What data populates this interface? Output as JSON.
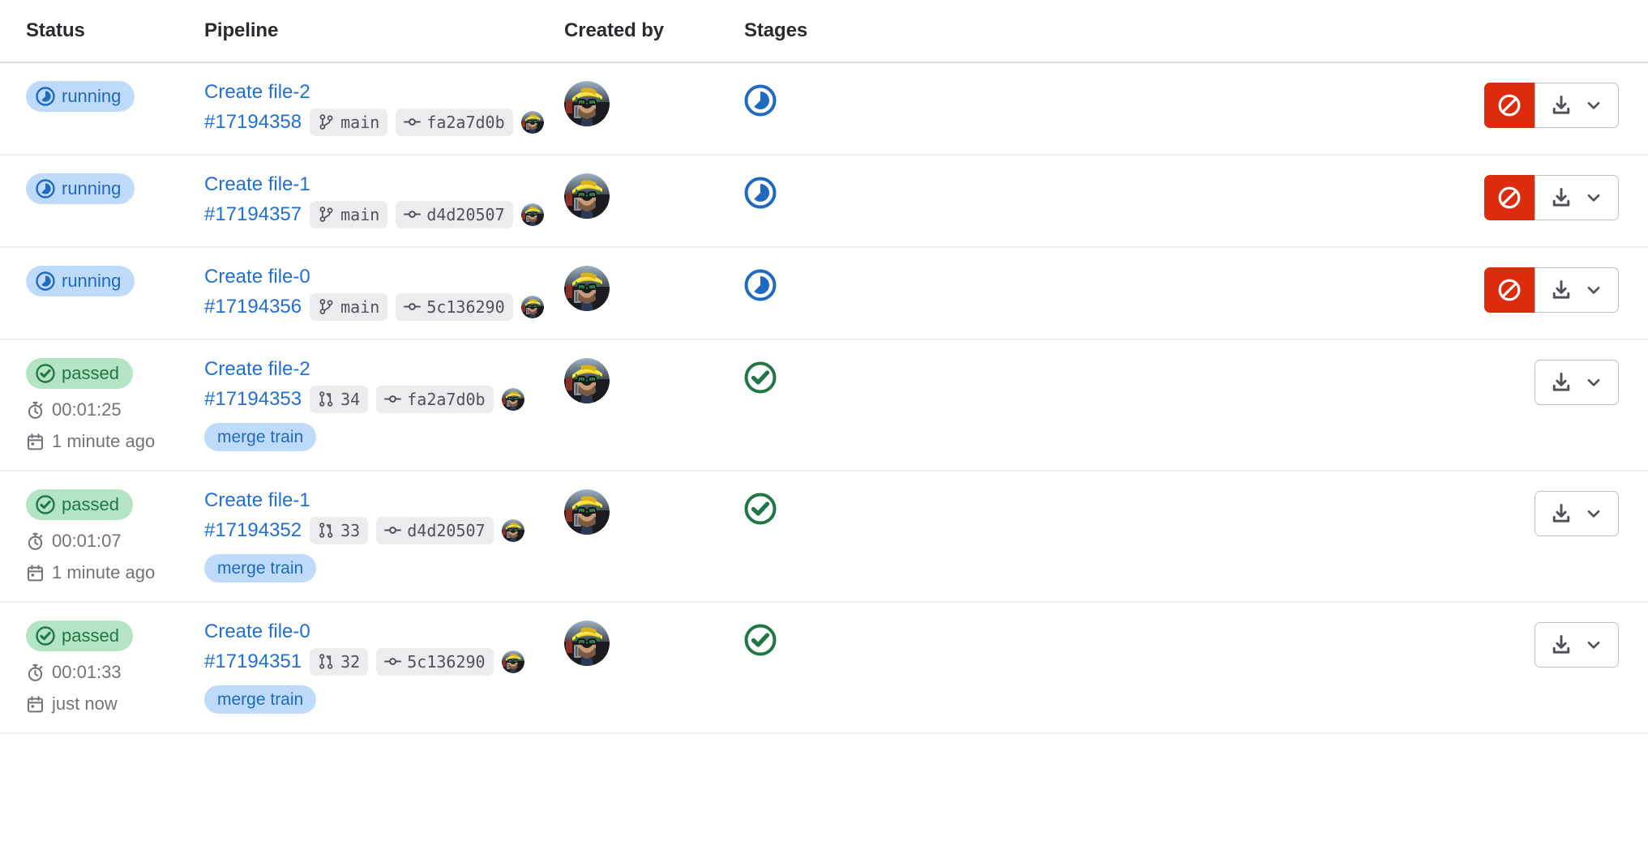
{
  "table": {
    "columns": [
      {
        "key": "status",
        "label": "Status"
      },
      {
        "key": "pipeline",
        "label": "Pipeline"
      },
      {
        "key": "created",
        "label": "Created by"
      },
      {
        "key": "stages",
        "label": "Stages"
      }
    ],
    "rows": [
      {
        "status": {
          "label": "running",
          "type": "running"
        },
        "duration": null,
        "time_ago": null,
        "pipeline": {
          "name": "Create file-2",
          "id": "#17194358",
          "ref_type": "branch",
          "ref": "main",
          "commit": "fa2a7d0b",
          "merge_train": null
        },
        "stage": {
          "type": "running"
        },
        "actions": {
          "cancel": true,
          "download": true,
          "cancel_label": "Cancel pipeline",
          "download_label": "Download artifacts"
        }
      },
      {
        "status": {
          "label": "running",
          "type": "running"
        },
        "duration": null,
        "time_ago": null,
        "pipeline": {
          "name": "Create file-1",
          "id": "#17194357",
          "ref_type": "branch",
          "ref": "main",
          "commit": "d4d20507",
          "merge_train": null
        },
        "stage": {
          "type": "running"
        },
        "actions": {
          "cancel": true,
          "download": true,
          "cancel_label": "Cancel pipeline",
          "download_label": "Download artifacts"
        }
      },
      {
        "status": {
          "label": "running",
          "type": "running"
        },
        "duration": null,
        "time_ago": null,
        "pipeline": {
          "name": "Create file-0",
          "id": "#17194356",
          "ref_type": "branch",
          "ref": "main",
          "commit": "5c136290",
          "merge_train": null
        },
        "stage": {
          "type": "running"
        },
        "actions": {
          "cancel": true,
          "download": true,
          "cancel_label": "Cancel pipeline",
          "download_label": "Download artifacts"
        }
      },
      {
        "status": {
          "label": "passed",
          "type": "passed"
        },
        "duration": "00:01:25",
        "time_ago": "1 minute ago",
        "pipeline": {
          "name": "Create file-2",
          "id": "#17194353",
          "ref_type": "merge_request",
          "ref": "34",
          "commit": "fa2a7d0b",
          "merge_train": "merge train"
        },
        "stage": {
          "type": "passed"
        },
        "actions": {
          "cancel": false,
          "download": true,
          "cancel_label": "Cancel pipeline",
          "download_label": "Download artifacts"
        }
      },
      {
        "status": {
          "label": "passed",
          "type": "passed"
        },
        "duration": "00:01:07",
        "time_ago": "1 minute ago",
        "pipeline": {
          "name": "Create file-1",
          "id": "#17194352",
          "ref_type": "merge_request",
          "ref": "33",
          "commit": "d4d20507",
          "merge_train": "merge train"
        },
        "stage": {
          "type": "passed"
        },
        "actions": {
          "cancel": false,
          "download": true,
          "cancel_label": "Cancel pipeline",
          "download_label": "Download artifacts"
        }
      },
      {
        "status": {
          "label": "passed",
          "type": "passed"
        },
        "duration": "00:01:33",
        "time_ago": "just now",
        "pipeline": {
          "name": "Create file-0",
          "id": "#17194351",
          "ref_type": "merge_request",
          "ref": "32",
          "commit": "5c136290",
          "merge_train": "merge train"
        },
        "stage": {
          "type": "passed"
        },
        "actions": {
          "cancel": false,
          "download": true,
          "cancel_label": "Cancel pipeline",
          "download_label": "Download artifacts"
        }
      }
    ]
  },
  "icons": {
    "status_running": "status-running-icon",
    "status_passed": "status-success-icon",
    "branch": "branch-icon",
    "merge_request": "merge-request-icon",
    "commit": "commit-icon",
    "duration": "stopwatch-icon",
    "calendar": "calendar-icon",
    "cancel": "cancel-icon",
    "download": "download-icon",
    "chevron": "chevron-down-icon",
    "avatar": "avatar"
  },
  "colors": {
    "link": "#1f6fd4",
    "running_bg": "#bfdbfb",
    "running_fg": "#1f69c0",
    "passed_bg": "#b3e5c4",
    "passed_fg": "#217645",
    "danger": "#dd2b0e",
    "muted": "#737278",
    "chip_bg": "#ececef",
    "border": "#ececef"
  }
}
